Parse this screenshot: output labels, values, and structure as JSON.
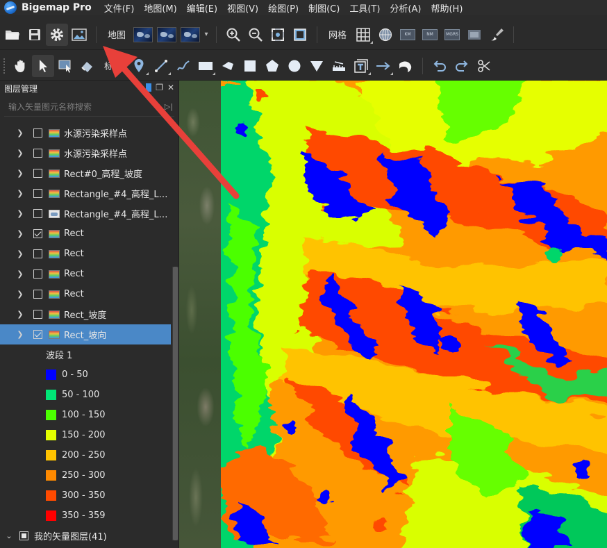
{
  "app": {
    "name": "Bigemap Pro"
  },
  "menu": [
    "文件(F)",
    "地图(M)",
    "编辑(E)",
    "视图(V)",
    "绘图(P)",
    "制图(C)",
    "工具(T)",
    "分析(A)",
    "帮助(H)"
  ],
  "toolbar1": {
    "map_label": "地图",
    "grid_label": "网格",
    "badges": [
      "LB",
      "KM",
      "NM",
      "MGRS"
    ]
  },
  "toolbar2": {
    "annotate_label": "标绘"
  },
  "panel": {
    "title": "图层管理",
    "search_placeholder": "输入矢量图元名称搜索",
    "layers": [
      {
        "label": "水源污染采样点",
        "checked": false,
        "icon": "raster-icon",
        "selected": false
      },
      {
        "label": "水源污染采样点",
        "checked": false,
        "icon": "raster-icon",
        "selected": false
      },
      {
        "label": "Rect#0_高程_坡度",
        "checked": false,
        "icon": "raster-icon",
        "selected": false
      },
      {
        "label": "Rectangle_#4_高程_Le...",
        "checked": false,
        "icon": "raster-icon",
        "selected": false
      },
      {
        "label": "Rectangle_#4_高程_Le...",
        "checked": false,
        "icon": "image-icon",
        "selected": false
      },
      {
        "label": "Rect",
        "checked": true,
        "icon": "raster-icon",
        "selected": false
      },
      {
        "label": "Rect",
        "checked": false,
        "icon": "raster-icon",
        "selected": false
      },
      {
        "label": "Rect",
        "checked": false,
        "icon": "raster-icon",
        "selected": false
      },
      {
        "label": "Rect",
        "checked": false,
        "icon": "raster-icon",
        "selected": false
      },
      {
        "label": "Rect_坡度",
        "checked": false,
        "icon": "raster-icon",
        "selected": false
      },
      {
        "label": "Rect_坡向",
        "checked": true,
        "icon": "raster-icon",
        "selected": true
      }
    ],
    "legend": {
      "title": "波段 1",
      "items": [
        {
          "label": "0 - 50",
          "color": "#0000ff"
        },
        {
          "label": "50 - 100",
          "color": "#00e676"
        },
        {
          "label": "100 - 150",
          "color": "#4cff00"
        },
        {
          "label": "150 - 200",
          "color": "#e4ff00"
        },
        {
          "label": "200 - 250",
          "color": "#ffc300"
        },
        {
          "label": "250 - 300",
          "color": "#ff8a00"
        },
        {
          "label": "300 - 350",
          "color": "#ff4a00"
        },
        {
          "label": "350 - 359",
          "color": "#ff0000"
        }
      ]
    },
    "vector_group": {
      "label": "我的矢量图层(41)"
    }
  },
  "colors": {
    "panel_bg": "#2b2b2b",
    "selection": "#4a88c7",
    "annotation_arrow": "#e8403a"
  }
}
